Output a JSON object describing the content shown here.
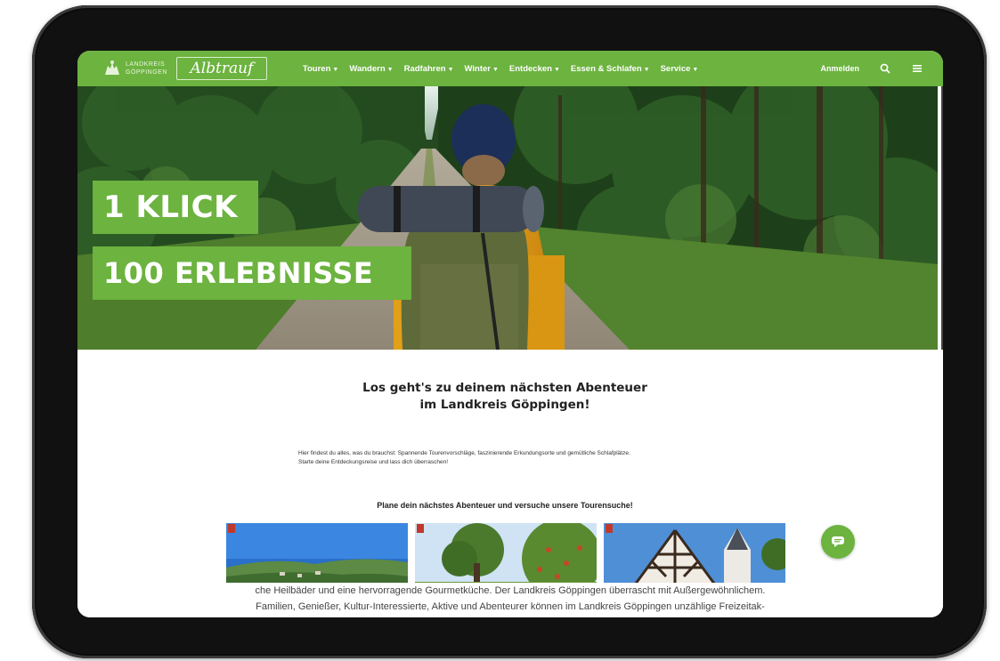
{
  "brand": {
    "landkreis_line1": "LANDKREIS",
    "landkreis_line2": "GÖPPINGEN",
    "albtrauf": "Albtrauf"
  },
  "nav": {
    "menu": [
      {
        "label": "Touren"
      },
      {
        "label": "Wandern"
      },
      {
        "label": "Radfahren"
      },
      {
        "label": "Winter"
      },
      {
        "label": "Entdecken"
      },
      {
        "label": "Essen & Schlafen"
      },
      {
        "label": "Service"
      }
    ],
    "login": "Anmelden",
    "search_icon": "search-icon",
    "menu_icon": "hamburger-icon"
  },
  "hero": {
    "badge1": "1 KLICK",
    "badge2": "100 ERLEBNISSE"
  },
  "content": {
    "headline_line1": "Los geht's zu deinem nächsten Abenteuer",
    "headline_line2": "im Landkreis Göppingen!",
    "intro_line1": "Hier findest du alles, was du brauchst: Spannende Tourenvorschläge, faszinierende Erkundungsorte und gemütliche Schlafplätze.",
    "intro_line2": "Starte deine Entdeckungsreise und lass dich überraschen!",
    "subhead": "Plane dein nächstes Abenteuer und versuche unsere Tourensuche!",
    "overlay_line1": "che Heilbäder und eine hervorragende Gourmetküche. Der Landkreis Göppingen überrascht mit Außergewöhnlichem.",
    "overlay_line2": "Familien, Genießer, Kultur-Interessierte, Aktive und Abenteurer können im Landkreis Göppingen unzählige Freizeitak-"
  },
  "colors": {
    "brand_green": "#6cb33f",
    "frame": "#111111"
  }
}
